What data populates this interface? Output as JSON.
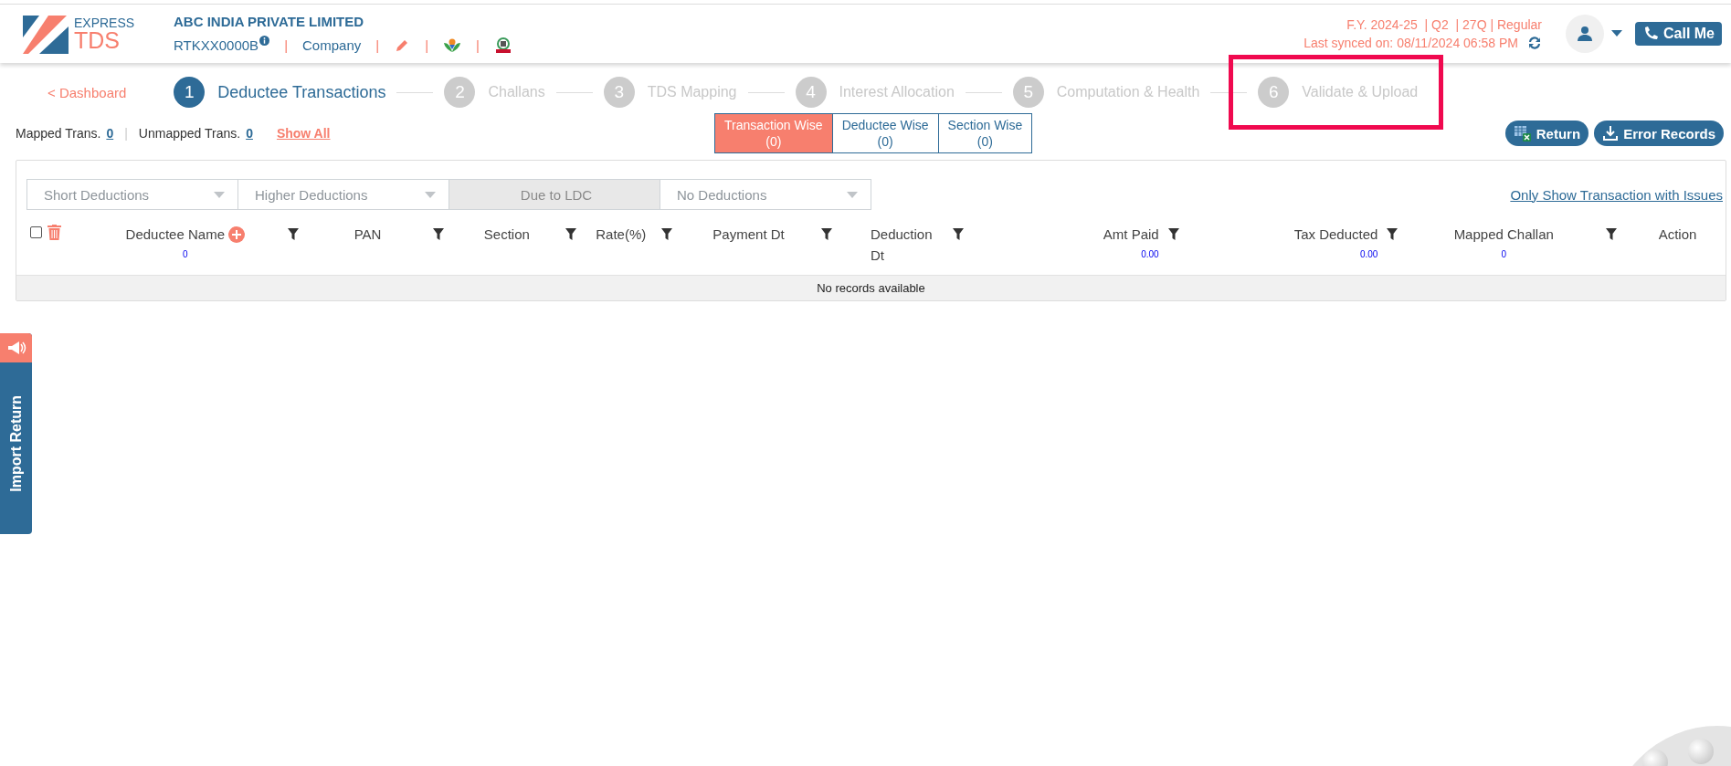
{
  "header": {
    "logo": {
      "line1": "EXPRESS",
      "line2": "TDS"
    },
    "company_name": "ABC INDIA PRIVATE LIMITED",
    "company_line": [
      {
        "kind": "pan",
        "text": "RTKXX0000B"
      },
      {
        "kind": "separator",
        "text": "|"
      },
      {
        "kind": "text",
        "text": "Company"
      },
      {
        "kind": "separator",
        "text": "|"
      },
      {
        "kind": "pencil"
      },
      {
        "kind": "separator",
        "text": "|"
      },
      {
        "kind": "flower"
      },
      {
        "kind": "separator",
        "text": "|"
      },
      {
        "kind": "emblem"
      }
    ],
    "period": "F.Y. 2024-25  | Q2  | 27Q | Regular",
    "last_synced": "Last synced on: 08/11/2024 06:58 PM",
    "call_button": "Call Me"
  },
  "stepper": {
    "back_link": "< Dashboard",
    "steps": [
      {
        "number": "1",
        "label": "Deductee Transactions",
        "selected": true,
        "highlighted": false
      },
      {
        "number": "2",
        "label": "Challans",
        "selected": false,
        "highlighted": false
      },
      {
        "number": "3",
        "label": "TDS Mapping",
        "selected": false,
        "highlighted": false
      },
      {
        "number": "4",
        "label": "Interest Allocation",
        "selected": false,
        "highlighted": false
      },
      {
        "number": "5",
        "label": "Computation & Health",
        "selected": false,
        "highlighted": false
      },
      {
        "number": "6",
        "label": "Validate & Upload",
        "selected": false,
        "highlighted": true
      }
    ]
  },
  "summary": {
    "mapped": {
      "label": "Mapped Trans.",
      "value": "0"
    },
    "separator": "|",
    "unmapped": {
      "label": "Unmapped Trans.",
      "value": "0"
    },
    "show_all": "Show All"
  },
  "view_tabs": [
    {
      "label": "Transaction Wise",
      "count": "(0)",
      "selected": true
    },
    {
      "label": "Deductee Wise",
      "count": "(0)",
      "selected": false
    },
    {
      "label": "Section Wise",
      "count": "(0)",
      "selected": false
    }
  ],
  "action_buttons": [
    {
      "kind": "excel",
      "label": "Return"
    },
    {
      "kind": "download",
      "label": "Error Records"
    }
  ],
  "filters": [
    {
      "label": "Short Deductions",
      "disabled": false
    },
    {
      "label": "Higher Deductions",
      "disabled": false
    },
    {
      "label": "Due to LDC",
      "disabled": true
    },
    {
      "label": "No Deductions",
      "disabled": false
    }
  ],
  "issues_link": "Only Show Transaction with Issues",
  "table": {
    "select_all": {
      "checked": false
    },
    "columns": [
      {
        "label": "Deductee Name",
        "subtotal": "0",
        "add": true,
        "filter": true
      },
      {
        "label": "PAN",
        "add": false,
        "filter": true
      },
      {
        "label": "Section",
        "add": false,
        "filter": true
      },
      {
        "label": "Rate(%)",
        "add": false,
        "filter": true
      },
      {
        "label": "Payment Dt",
        "add": false,
        "filter": true
      },
      {
        "label": "Deduction Dt",
        "add": false,
        "filter": true
      },
      {
        "label": "Amt Paid",
        "subtotal": "0.00",
        "add": false,
        "filter": true
      },
      {
        "label": "Tax Deducted",
        "subtotal": "0.00",
        "add": false,
        "filter": true
      },
      {
        "label": "Mapped Challan",
        "subtotal": "0",
        "add": false,
        "filter": true
      },
      {
        "label": "Action",
        "add": false,
        "filter": false
      }
    ],
    "empty_message": "No records available"
  },
  "side_tab": {
    "label": "Import Return"
  }
}
